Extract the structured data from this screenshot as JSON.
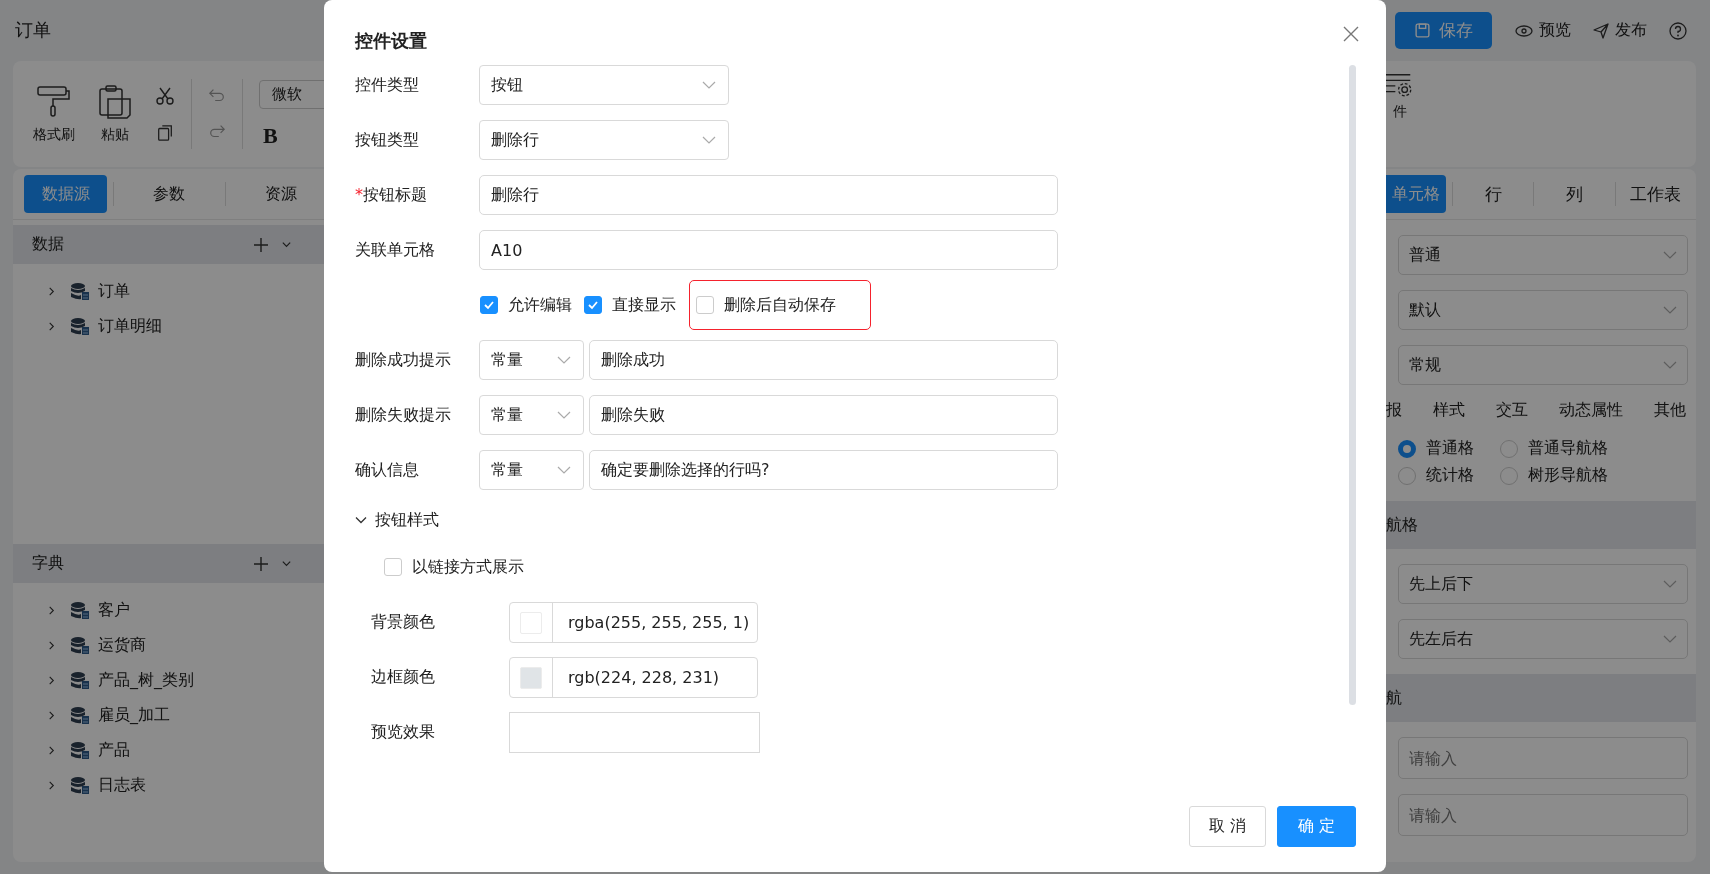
{
  "app": {
    "title": "订单",
    "save": "保存",
    "preview": "预览",
    "publish": "发布"
  },
  "ribbon": {
    "tools": [
      {
        "kind": "brush",
        "label": "格式刷"
      },
      {
        "kind": "paste",
        "label": "粘贴"
      }
    ],
    "font": "微软",
    "bold": "B",
    "event_label": "件"
  },
  "left_panel": {
    "tabs": [
      {
        "label": "数据源",
        "selected": true
      },
      {
        "label": "参数",
        "selected": false
      },
      {
        "label": "资源",
        "selected": false
      }
    ],
    "sections": [
      {
        "title": "数据",
        "items": [
          {
            "label": "订单",
            "expanded": false
          },
          {
            "label": "订单明细",
            "expanded": false
          }
        ]
      },
      {
        "title": "字典",
        "items": [
          {
            "label": "客户",
            "expanded": false
          },
          {
            "label": "运货商",
            "expanded": false
          },
          {
            "label": "产品_树_类别",
            "expanded": false
          },
          {
            "label": "雇员_加工",
            "expanded": false
          },
          {
            "label": "产品",
            "expanded": false
          },
          {
            "label": "日志表",
            "expanded": false
          }
        ]
      }
    ]
  },
  "right_panel": {
    "tabs": [
      {
        "label": "单元格",
        "selected": true
      },
      {
        "label": "行",
        "selected": false
      },
      {
        "label": "列",
        "selected": false
      },
      {
        "label": "工作表",
        "selected": false
      }
    ],
    "selects": [
      "普通",
      "默认",
      "常规"
    ],
    "subtabs": [
      "报",
      "样式",
      "交互",
      "动态属性",
      "其他"
    ],
    "radios": [
      {
        "label": "普通格",
        "selected": true
      },
      {
        "label": "普通导航格",
        "selected": false
      },
      {
        "label": "统计格",
        "selected": false
      },
      {
        "label": "树形导航格",
        "selected": false
      }
    ],
    "nav_order": {
      "title": "航格",
      "selects": [
        "先上后下",
        "先左后右"
      ]
    },
    "nav": {
      "title": "航",
      "inputs": [
        {
          "placeholder": "请输入"
        },
        {
          "placeholder": "请输入"
        }
      ]
    }
  },
  "dialog": {
    "title": "控件设置",
    "rows": [
      {
        "kind": "select",
        "label": "控件类型",
        "value": "按钮"
      },
      {
        "kind": "select",
        "label": "按钮类型",
        "value": "删除行"
      },
      {
        "kind": "input",
        "label": "按钮标题",
        "required_mark": "*",
        "value": "删除行"
      },
      {
        "kind": "input",
        "label": "关联单元格",
        "value": "A10"
      },
      {
        "kind": "checks",
        "items": [
          {
            "label": "允许编辑",
            "checked": true,
            "highlighted": false
          },
          {
            "label": "直接显示",
            "checked": true,
            "highlighted": false
          },
          {
            "label": "删除后自动保存",
            "checked": false,
            "highlighted": true
          }
        ]
      },
      {
        "kind": "mode_input",
        "label": "删除成功提示",
        "mode": "常量",
        "value": "删除成功"
      },
      {
        "kind": "mode_input",
        "label": "删除失败提示",
        "mode": "常量",
        "value": "删除失败"
      },
      {
        "kind": "mode_input",
        "label": "确认信息",
        "mode": "常量",
        "value": "确定要删除选择的行吗?"
      }
    ],
    "style_section": {
      "title": "按钮样式",
      "expanded": true,
      "link": {
        "label": "以链接方式展示",
        "checked": false
      },
      "colors": [
        {
          "label": "背景颜色",
          "color": "#ffffff",
          "value": "rgba(255, 255, 255, 1)"
        },
        {
          "label": "边框颜色",
          "color": "#e0e4e7",
          "value": "rgb(224, 228, 231)"
        }
      ],
      "preview_label": "预览效果"
    },
    "buttons": {
      "cancel": "取 消",
      "ok": "确 定"
    }
  }
}
